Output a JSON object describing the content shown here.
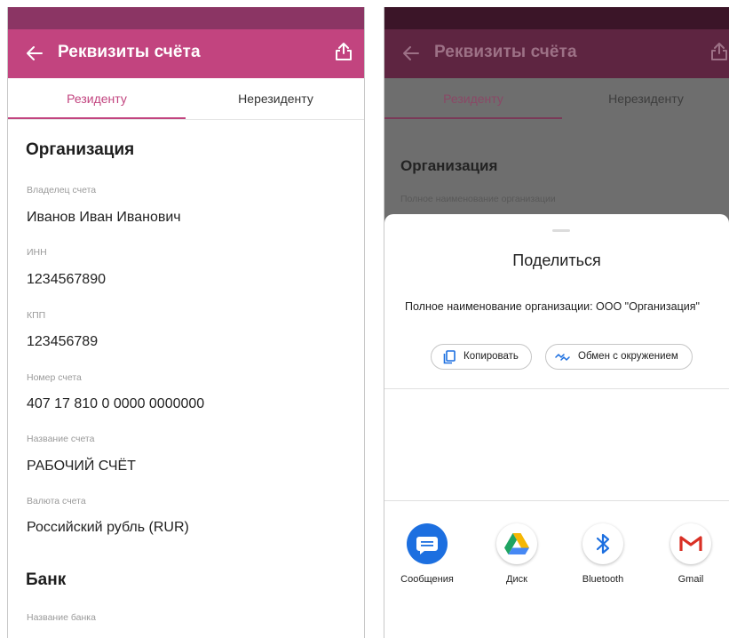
{
  "left": {
    "header": {
      "title": "Реквизиты счёта"
    },
    "tabs": [
      {
        "label": "Резиденту"
      },
      {
        "label": "Нерезиденту"
      }
    ],
    "org_section": "Организация",
    "fields": [
      {
        "label": "Владелец счета",
        "value": "Иванов Иван Иванович"
      },
      {
        "label": "ИНН",
        "value": "1234567890"
      },
      {
        "label": "КПП",
        "value": "123456789"
      },
      {
        "label": "Номер счета",
        "value": "407 17 810 0 0000 0000000"
      },
      {
        "label": "Название счета",
        "value": "РАБОЧИЙ СЧЁТ"
      },
      {
        "label": "Валюта счета",
        "value": "Российский рубль (RUR)"
      }
    ],
    "bank_section": "Банк",
    "bank_field_label": "Название банка"
  },
  "right": {
    "header": {
      "title": "Реквизиты счёта"
    },
    "tabs": [
      {
        "label": "Резиденту"
      },
      {
        "label": "Нерезиденту"
      }
    ],
    "org_section": "Организация",
    "org_field_label": "Полное наименование организации",
    "share_sheet": {
      "title": "Поделиться",
      "text": "Полное наименование организации: ООО \"Организация\"",
      "copy_label": "Копировать",
      "nearby_label": "Обмен с окружением",
      "apps": [
        {
          "label": "Сообщения",
          "icon": "messages-icon"
        },
        {
          "label": "Диск",
          "icon": "drive-icon"
        },
        {
          "label": "Bluetooth",
          "icon": "bluetooth-icon"
        },
        {
          "label": "Gmail",
          "icon": "gmail-icon"
        }
      ]
    }
  },
  "colors": {
    "accent": "#c2447f",
    "status_bar": "#8b3564",
    "overlay_bg": "#6e6e6e",
    "messages_blue": "#1c6fe0"
  }
}
